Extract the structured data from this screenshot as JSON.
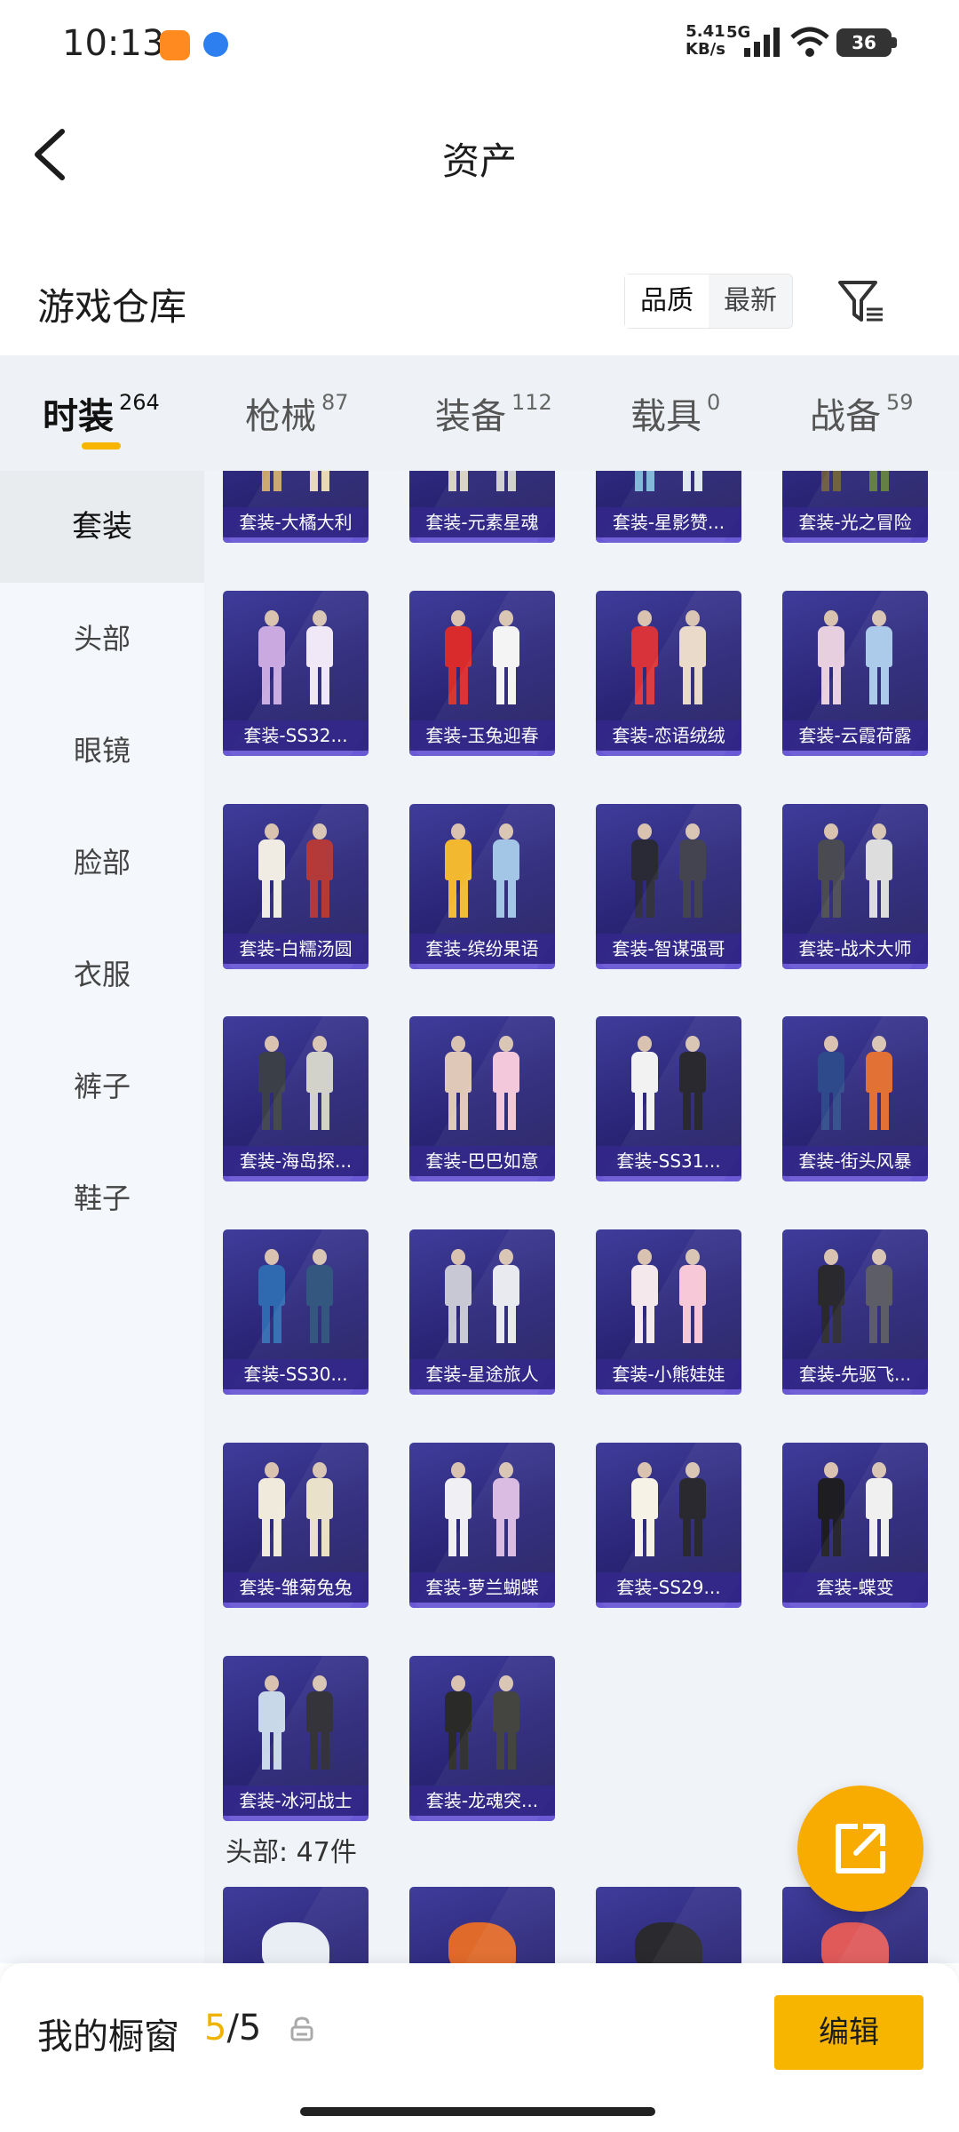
{
  "status_bar": {
    "time": "10:13",
    "net_speed": "5.41",
    "net_unit": "KB/s",
    "network": "5G",
    "battery": "36",
    "icons": [
      "shopping-app-icon",
      "browser-app-icon",
      "signal-icon",
      "wifi-icon",
      "battery-icon"
    ]
  },
  "header": {
    "title": "资产",
    "back_icon": "chevron-left-icon"
  },
  "warehouse": {
    "title": "游戏仓库",
    "sort_options": [
      "品质",
      "最新"
    ],
    "active_sort": "品质",
    "filter_icon": "filter-icon"
  },
  "tabs": [
    {
      "label": "时装",
      "count": "264",
      "active": true
    },
    {
      "label": "枪械",
      "count": "87"
    },
    {
      "label": "装备",
      "count": "112"
    },
    {
      "label": "载具",
      "count": "0"
    },
    {
      "label": "战备",
      "count": "59"
    }
  ],
  "side_nav": [
    {
      "label": "套装",
      "active": true
    },
    {
      "label": "头部"
    },
    {
      "label": "眼镜"
    },
    {
      "label": "脸部"
    },
    {
      "label": "衣服"
    },
    {
      "label": "裤子"
    },
    {
      "label": "鞋子"
    }
  ],
  "items": [
    {
      "label": "套装-大橘大利"
    },
    {
      "label": "套装-元素星魂"
    },
    {
      "label": "套装-星影赞..."
    },
    {
      "label": "套装-光之冒险"
    },
    {
      "label": "套装-SS32..."
    },
    {
      "label": "套装-玉兔迎春"
    },
    {
      "label": "套装-恋语绒绒"
    },
    {
      "label": "套装-云霞荷露"
    },
    {
      "label": "套装-白糯汤圆"
    },
    {
      "label": "套装-缤纷果语"
    },
    {
      "label": "套装-智谋强哥"
    },
    {
      "label": "套装-战术大师"
    },
    {
      "label": "套装-海岛探..."
    },
    {
      "label": "套装-巴巴如意"
    },
    {
      "label": "套装-SS31..."
    },
    {
      "label": "套装-街头风暴"
    },
    {
      "label": "套装-SS30..."
    },
    {
      "label": "套装-星途旅人"
    },
    {
      "label": "套装-小熊娃娃"
    },
    {
      "label": "套装-先驱飞..."
    },
    {
      "label": "套装-雏菊兔兔"
    },
    {
      "label": "套装-萝兰蝴蝶"
    },
    {
      "label": "套装-SS29..."
    },
    {
      "label": "套装-蝶变"
    },
    {
      "label": "套装-冰河战士"
    },
    {
      "label": "套装-龙魂突..."
    }
  ],
  "next_section": {
    "label": "头部: 47件"
  },
  "bottom_bar": {
    "showcase_label": "我的橱窗",
    "showcase_used": "5",
    "showcase_total": "/5",
    "edit_label": "编辑",
    "share_icon": "share-external-icon",
    "lock_icon": "lock-icon"
  },
  "colors": {
    "accent": "#f7b500",
    "card_bg": "#2a2577",
    "card_label_bg": "#34288c",
    "tab_bar_bg": "#eef2f6"
  }
}
